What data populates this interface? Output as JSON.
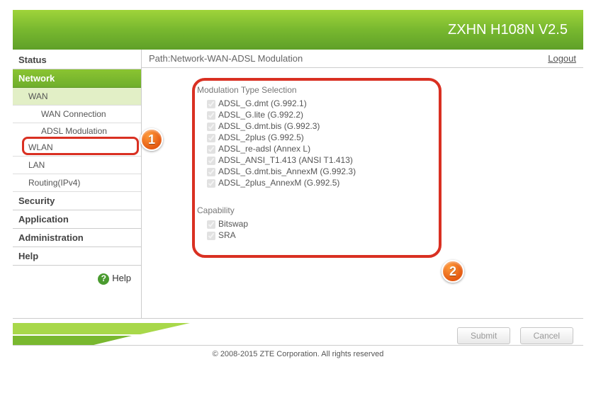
{
  "header": {
    "title": "ZXHN H108N V2.5"
  },
  "nav": {
    "status": "Status",
    "network": "Network",
    "wan": "WAN",
    "wan_connection": "WAN Connection",
    "adsl_modulation": "ADSL Modulation",
    "wlan": "WLAN",
    "lan": "LAN",
    "routing": "Routing(IPv4)",
    "security": "Security",
    "application": "Application",
    "administration": "Administration",
    "help_item": "Help",
    "help_label": "Help"
  },
  "path": {
    "label": "Path:Network-WAN-ADSL Modulation",
    "logout": "Logout"
  },
  "modulation": {
    "title": "Modulation Type Selection",
    "items": [
      "ADSL_G.dmt (G.992.1)",
      "ADSL_G.lite (G.992.2)",
      "ADSL_G.dmt.bis (G.992.3)",
      "ADSL_2plus (G.992.5)",
      "ADSL_re-adsl (Annex L)",
      "ADSL_ANSI_T1.413 (ANSI T1.413)",
      "ADSL_G.dmt.bis_AnnexM (G.992.3)",
      "ADSL_2plus_AnnexM (G.992.5)"
    ]
  },
  "capability": {
    "title": "Capability",
    "items": [
      "Bitswap",
      "SRA"
    ]
  },
  "footer": {
    "submit": "Submit",
    "cancel": "Cancel",
    "copyright": "© 2008-2015 ZTE Corporation. All rights reserved"
  },
  "annotations": {
    "badge1": "1",
    "badge2": "2"
  }
}
